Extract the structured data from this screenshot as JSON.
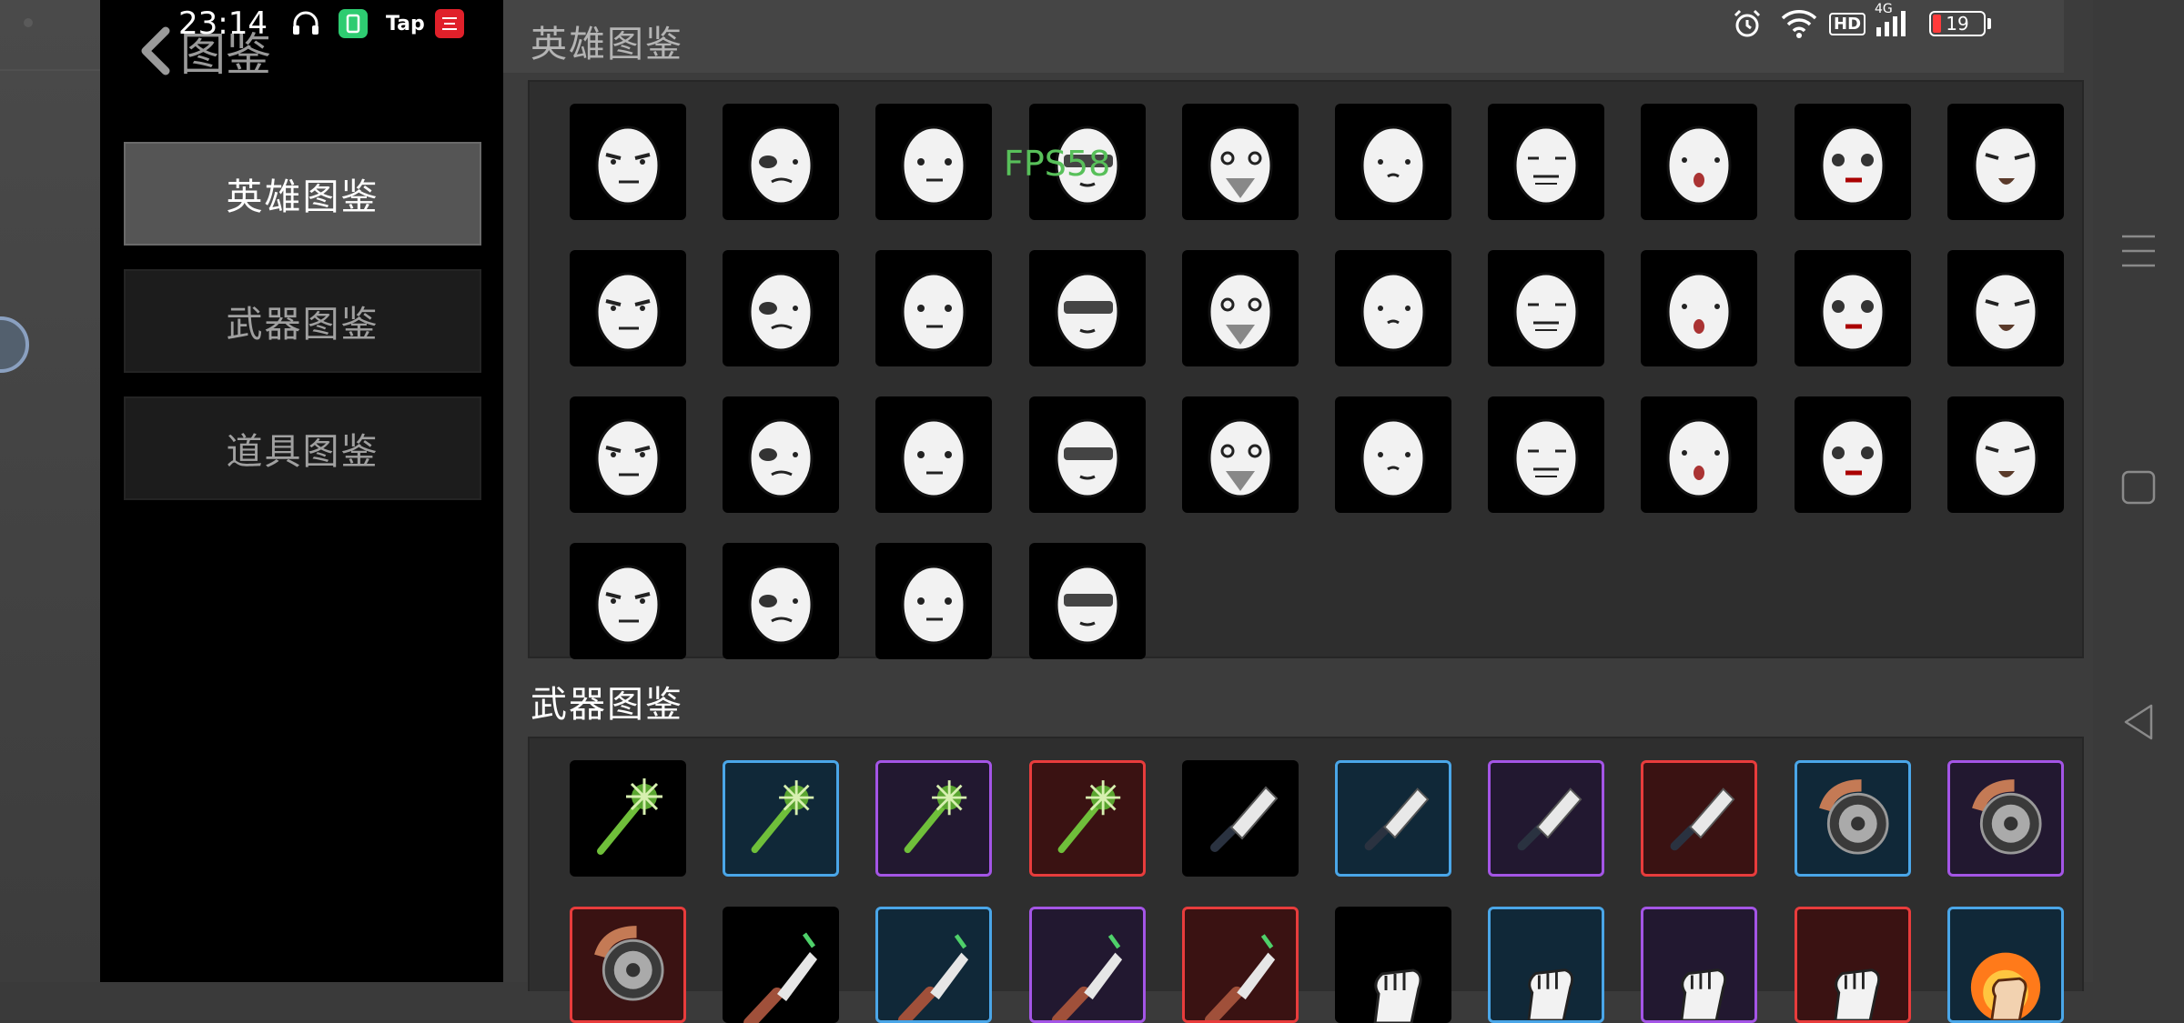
{
  "status_bar": {
    "time": "23:14",
    "tap_label": "Tap",
    "hd_label": "HD",
    "network_label": "4G",
    "battery": "19"
  },
  "header": {
    "back_label": "图鉴"
  },
  "sidebar": {
    "items": [
      {
        "label": "英雄图鉴",
        "active": true
      },
      {
        "label": "武器图鉴",
        "active": false
      },
      {
        "label": "道具图鉴",
        "active": false
      }
    ]
  },
  "overlay": {
    "fps": "FPS58"
  },
  "sections": {
    "heroes": {
      "title": "英雄图鉴",
      "items": [
        "hero-01",
        "hero-02",
        "hero-03",
        "hero-04",
        "hero-05",
        "hero-06",
        "hero-07",
        "hero-08",
        "hero-09",
        "hero-10",
        "hero-11",
        "hero-12",
        "hero-13",
        "hero-14",
        "hero-15",
        "hero-16",
        "hero-17",
        "hero-18",
        "hero-19",
        "hero-20",
        "hero-21",
        "hero-22",
        "hero-23",
        "hero-24",
        "hero-25",
        "hero-26",
        "hero-27",
        "hero-28",
        "hero-29",
        "hero-30",
        "hero-31",
        "hero-32",
        "hero-33",
        "hero-34"
      ]
    },
    "weapons": {
      "title": "武器图鉴",
      "items": [
        {
          "weapon": "spiked-club",
          "rarity": "common"
        },
        {
          "weapon": "spiked-club",
          "rarity": "rare"
        },
        {
          "weapon": "spiked-club",
          "rarity": "epic"
        },
        {
          "weapon": "spiked-club",
          "rarity": "legendary"
        },
        {
          "weapon": "cleaver",
          "rarity": "common"
        },
        {
          "weapon": "cleaver",
          "rarity": "rare"
        },
        {
          "weapon": "cleaver",
          "rarity": "epic"
        },
        {
          "weapon": "cleaver",
          "rarity": "legendary"
        },
        {
          "weapon": "saw-blade",
          "rarity": "rare"
        },
        {
          "weapon": "saw-blade",
          "rarity": "epic"
        },
        {
          "weapon": "saw-blade",
          "rarity": "legendary"
        },
        {
          "weapon": "machete",
          "rarity": "common"
        },
        {
          "weapon": "machete",
          "rarity": "rare"
        },
        {
          "weapon": "machete",
          "rarity": "epic"
        },
        {
          "weapon": "machete",
          "rarity": "legendary"
        },
        {
          "weapon": "fist",
          "rarity": "common"
        },
        {
          "weapon": "fist",
          "rarity": "rare"
        },
        {
          "weapon": "fist",
          "rarity": "epic"
        },
        {
          "weapon": "fist",
          "rarity": "legendary"
        },
        {
          "weapon": "flame-fist",
          "rarity": "rare"
        }
      ]
    }
  },
  "colors": {
    "rare": "#4aa6e8",
    "epic": "#a455e6",
    "legendary": "#e83c3c",
    "active_menu": "#555555"
  }
}
